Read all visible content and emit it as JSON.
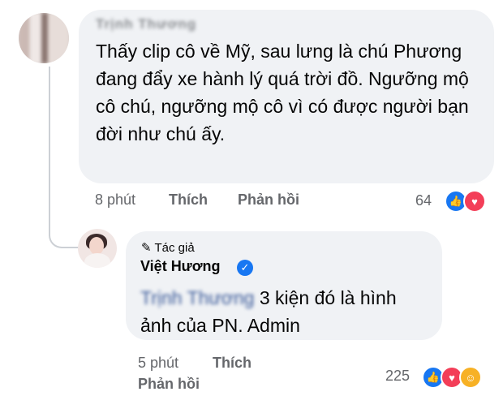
{
  "comment_1": {
    "author": "Trịnh Thương",
    "text": "Thấy clip cô về Mỹ, sau lưng là chú Phương đang đẩy xe hành lý quá trời đồ.  Ngưỡng mộ cô chú, ngưỡng mộ cô vì có được người bạn đời như chú ấy.",
    "time": "8 phút",
    "like_label": "Thích",
    "reply_label": "Phản hồi",
    "reaction_count": "64",
    "reactions": [
      "like-icon",
      "love-icon"
    ]
  },
  "comment_2": {
    "author_tag": "Tác giả",
    "author": "Việt Hương",
    "mention": "Trịnh Thương",
    "text": "3 kiện đó là hình ảnh của PN. Admin",
    "time": "5 phút",
    "like_label": "Thích",
    "reply_label": "Phản hồi",
    "reaction_count": "225",
    "reactions": [
      "like-icon",
      "love-icon",
      "care-icon"
    ]
  }
}
